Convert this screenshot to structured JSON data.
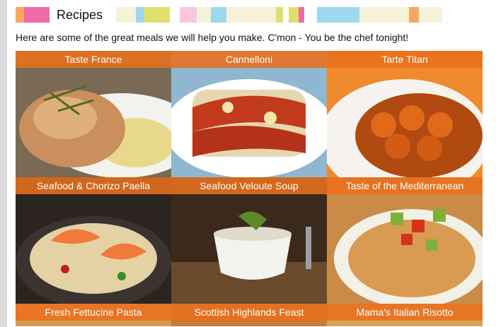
{
  "header": {
    "title": "Recipes",
    "stripe_colors": [
      "#f9a75f",
      "#f06aa8",
      "#f06aa8",
      "#ffffff",
      "#f5f2d8",
      "#9ed7ef",
      "#e0df6b",
      "#ffffff",
      "#f8c8de",
      "#f5f2d8",
      "#9ed7ef",
      "#f5f2d8",
      "#e0df6b",
      "#ffffff",
      "#f06aa8",
      "#ffffff",
      "#9ed7ef",
      "#f5f2d8",
      "#f9a75f",
      "#f5f2d8"
    ]
  },
  "intro": "Here are some of the great meals we will help you make. C'mon - You be the chef tonight!",
  "colors": {
    "accent": "#e86f1c"
  },
  "recipes": [
    {
      "label": "Taste France"
    },
    {
      "label": "Cannelloni"
    },
    {
      "label": "Tarte Titan"
    },
    {
      "label": "Seafood & Chorizo Paella"
    },
    {
      "label": "Seafood Veloute Soup"
    },
    {
      "label": "Taste of the Mediterranean"
    },
    {
      "label": "Fresh Fettucine Pasta"
    },
    {
      "label": "Scottish Highlands Feast"
    },
    {
      "label": "Mama's Italian Risotto"
    }
  ]
}
